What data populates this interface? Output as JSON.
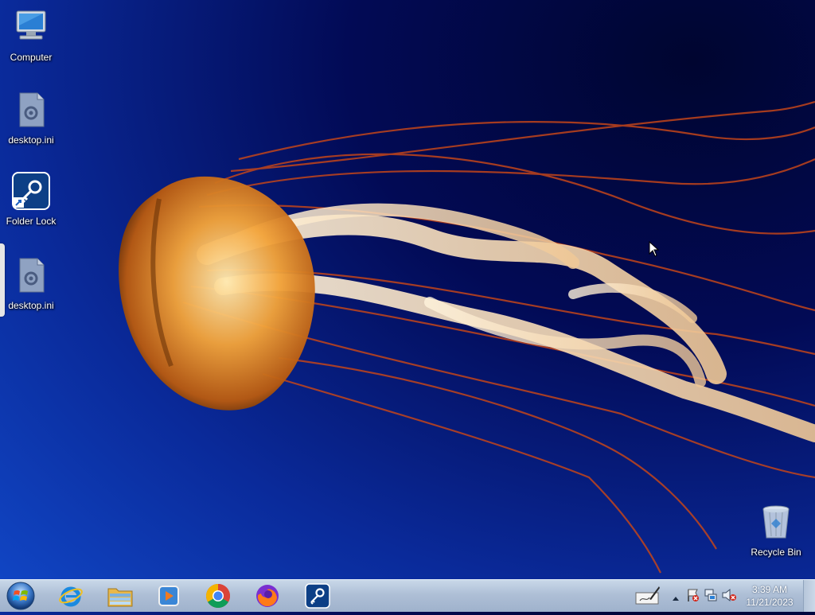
{
  "desktop": {
    "icons": [
      {
        "label": "Computer",
        "icon": "computer-icon"
      },
      {
        "label": "desktop.ini",
        "icon": "settings-file-icon"
      },
      {
        "label": "Folder Lock",
        "icon": "folder-lock-icon"
      },
      {
        "label": "desktop.ini",
        "icon": "settings-file-icon"
      },
      {
        "label": "Recycle Bin",
        "icon": "recycle-bin-icon"
      }
    ]
  },
  "taskbar": {
    "pinned": [
      {
        "icon": "internet-explorer-icon"
      },
      {
        "icon": "file-explorer-icon"
      },
      {
        "icon": "media-player-icon"
      },
      {
        "icon": "chrome-icon"
      },
      {
        "icon": "firefox-icon"
      },
      {
        "icon": "folder-lock-icon"
      }
    ],
    "clock": {
      "time": "3:39 AM",
      "date": "11/21/2023"
    }
  },
  "colors": {
    "taskbar": "#aebfd6",
    "wallpaper_dark": "#020a55",
    "wallpaper_light": "#1148c8",
    "jellyfish": "#e8962a"
  }
}
